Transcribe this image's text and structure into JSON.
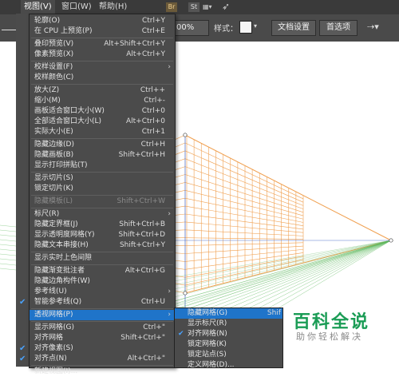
{
  "menubar": {
    "items": [
      {
        "label": "视图(V)"
      },
      {
        "label": "窗口(W)"
      },
      {
        "label": "帮助(H)"
      }
    ],
    "app_badges": [
      "Br",
      "St"
    ]
  },
  "toolbar": {
    "zoom_value": "00%",
    "style_label": "样式：",
    "doc_settings_label": "文档设置",
    "preferences_label": "首选项"
  },
  "view_menu": {
    "items": [
      {
        "label": "轮廓(O)",
        "shortcut": "Ctrl+Y"
      },
      {
        "label": "在 CPU 上预览(P)",
        "shortcut": "Ctrl+E"
      },
      {
        "label": "叠印预览(V)",
        "shortcut": "Alt+Shift+Ctrl+Y"
      },
      {
        "label": "像素预览(X)",
        "shortcut": "Alt+Ctrl+Y"
      },
      {
        "label": "校样设置(F)",
        "shortcut": ""
      },
      {
        "label": "校样颜色(C)",
        "shortcut": ""
      },
      {
        "label": "放大(Z)",
        "shortcut": "Ctrl++"
      },
      {
        "label": "缩小(M)",
        "shortcut": "Ctrl+-"
      },
      {
        "label": "画板适合窗口大小(W)",
        "shortcut": "Ctrl+0"
      },
      {
        "label": "全部适合窗口大小(L)",
        "shortcut": "Alt+Ctrl+0"
      },
      {
        "label": "实际大小(E)",
        "shortcut": "Ctrl+1"
      },
      {
        "label": "隐藏边缘(D)",
        "shortcut": "Ctrl+H"
      },
      {
        "label": "隐藏画板(B)",
        "shortcut": "Shift+Ctrl+H"
      },
      {
        "label": "显示打印拼贴(T)",
        "shortcut": ""
      },
      {
        "label": "显示切片(S)",
        "shortcut": ""
      },
      {
        "label": "锁定切片(K)",
        "shortcut": ""
      },
      {
        "label": "隐藏模板(L)",
        "shortcut": "Shift+Ctrl+W"
      },
      {
        "label": "标尺(R)",
        "shortcut": ""
      },
      {
        "label": "隐藏定界框(J)",
        "shortcut": "Shift+Ctrl+B"
      },
      {
        "label": "显示透明度网格(Y)",
        "shortcut": "Shift+Ctrl+D"
      },
      {
        "label": "隐藏文本串接(H)",
        "shortcut": "Shift+Ctrl+Y"
      },
      {
        "label": "显示实时上色间隙",
        "shortcut": ""
      },
      {
        "label": "隐藏渐变批注者",
        "shortcut": "Alt+Ctrl+G"
      },
      {
        "label": "隐藏边角构件(W)",
        "shortcut": ""
      },
      {
        "label": "参考线(U)",
        "shortcut": ""
      },
      {
        "label": "智能参考线(Q)",
        "shortcut": "Ctrl+U"
      },
      {
        "label": "透视网格(P)",
        "shortcut": ""
      },
      {
        "label": "显示网格(G)",
        "shortcut": "Ctrl+\""
      },
      {
        "label": "对齐网格",
        "shortcut": "Shift+Ctrl+\""
      },
      {
        "label": "对齐像素(S)",
        "shortcut": ""
      },
      {
        "label": "对齐点(N)",
        "shortcut": "Alt+Ctrl+\""
      },
      {
        "label": "新建视图(I)...",
        "shortcut": ""
      }
    ]
  },
  "perspective_submenu": {
    "items": [
      {
        "label": "隐藏网格(G)",
        "shortcut": "Shif"
      },
      {
        "label": "显示标尺(R)",
        "shortcut": ""
      },
      {
        "label": "对齐网格(N)",
        "shortcut": ""
      },
      {
        "label": "锁定网格(K)",
        "shortcut": ""
      },
      {
        "label": "锁定站点(S)",
        "shortcut": ""
      },
      {
        "label": "定义网格(D)...",
        "shortcut": ""
      }
    ]
  },
  "watermark": {
    "title": "百科全说",
    "subtitle": "助你轻松解决"
  },
  "colors": {
    "grid_orange": "#f0a050",
    "grid_green": "#5cb85c",
    "grid_blue": "#5577cc",
    "menu_bg": "#4b4b4b",
    "highlight": "#1f74c9",
    "watermark_green": "#1a9c55"
  }
}
